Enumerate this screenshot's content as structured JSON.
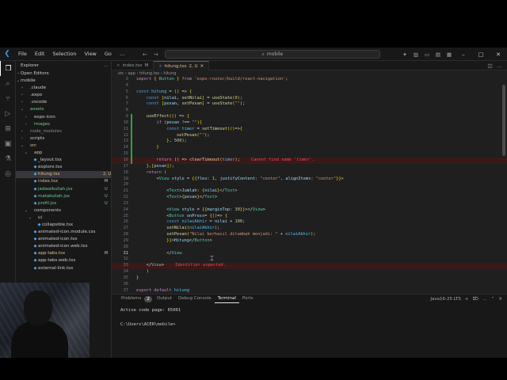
{
  "titlebar": {
    "menu": [
      "File",
      "Edit",
      "Selection",
      "View",
      "Go"
    ],
    "more": "…",
    "search": "mobile"
  },
  "sidebar": {
    "title": "Explorer",
    "section": "Open Editors",
    "root": "mobile",
    "items": [
      {
        "label": ".claude",
        "indent": 1,
        "chev": "›",
        "color": "#cccccc",
        "badge": ""
      },
      {
        "label": ".expo",
        "indent": 1,
        "chev": "›",
        "color": "#cccccc",
        "badge": ""
      },
      {
        "label": ".vscode",
        "indent": 1,
        "chev": "›",
        "color": "#cccccc",
        "badge": ""
      },
      {
        "label": "assets",
        "indent": 1,
        "chev": "⌄",
        "color": "#73c991",
        "badge": ""
      },
      {
        "label": "expo-icon",
        "indent": 2,
        "chev": "›",
        "color": "#cccccc",
        "badge": ""
      },
      {
        "label": "images",
        "indent": 2,
        "chev": "›",
        "color": "#73c991",
        "badge": ""
      },
      {
        "label": "node_modules",
        "indent": 1,
        "chev": "›",
        "color": "#8c8c8c",
        "badge": ""
      },
      {
        "label": "scripts",
        "indent": 1,
        "chev": "›",
        "color": "#cccccc",
        "badge": ""
      },
      {
        "label": "src",
        "indent": 1,
        "chev": "⌄",
        "color": "#e2c08d",
        "badge": ""
      },
      {
        "label": "app",
        "indent": 2,
        "chev": "⌄",
        "color": "#e2c08d",
        "badge": ""
      },
      {
        "label": "_layout.tsx",
        "indent": 3,
        "chev": "",
        "color": "#cccccc",
        "badge": ""
      },
      {
        "label": "explore.tsx",
        "indent": 3,
        "chev": "",
        "color": "#cccccc",
        "badge": ""
      },
      {
        "label": "hitung.tsx",
        "indent": 3,
        "chev": "",
        "color": "#e2c08d",
        "badge": "2, U",
        "selected": true
      },
      {
        "label": "index.tsx",
        "indent": 3,
        "chev": "",
        "color": "#e2c08d",
        "badge": "M"
      },
      {
        "label": "jadwalkuliah.jsx",
        "indent": 3,
        "chev": "",
        "color": "#73c991",
        "badge": "U"
      },
      {
        "label": "matakuliah.jsx",
        "indent": 3,
        "chev": "",
        "color": "#73c991",
        "badge": "U"
      },
      {
        "label": "profil.jsx",
        "indent": 3,
        "chev": "",
        "color": "#73c991",
        "badge": "U"
      },
      {
        "label": "components",
        "indent": 2,
        "chev": "⌄",
        "color": "#cccccc",
        "badge": ""
      },
      {
        "label": "ui",
        "indent": 3,
        "chev": "⌄",
        "color": "#cccccc",
        "badge": ""
      },
      {
        "label": "collapsible.tsx",
        "indent": 4,
        "chev": "",
        "color": "#cccccc",
        "badge": ""
      },
      {
        "label": "animated-icon.module.css",
        "indent": 3,
        "chev": "",
        "color": "#cccccc",
        "badge": ""
      },
      {
        "label": "animated-icon.tsx",
        "indent": 3,
        "chev": "",
        "color": "#cccccc",
        "badge": ""
      },
      {
        "label": "animated-icon.web.tsx",
        "indent": 3,
        "chev": "",
        "color": "#cccccc",
        "badge": ""
      },
      {
        "label": "app-tabs.tsx",
        "indent": 3,
        "chev": "",
        "color": "#e2c08d",
        "badge": "M"
      },
      {
        "label": "app-tabs.web.tsx",
        "indent": 3,
        "chev": "",
        "color": "#cccccc",
        "badge": ""
      },
      {
        "label": "external-link.tsx",
        "indent": 3,
        "chev": "",
        "color": "#cccccc",
        "badge": ""
      }
    ]
  },
  "tabs": [
    {
      "label": "index.tsx",
      "badge": "M",
      "active": false
    },
    {
      "label": "hitung.tsx",
      "badge": "2, U",
      "active": true
    }
  ],
  "breadcrumb": "src › app › hitung.tsx › hitung",
  "code": [
    {
      "n": "3",
      "text": "import { Button } from 'expo-router/build/react-navigation';"
    },
    {
      "n": "4",
      "text": ""
    },
    {
      "n": "5",
      "text": "const hitung = () => {"
    },
    {
      "n": "6",
      "text": "    const [nilai, setNilai] = useState(0);"
    },
    {
      "n": "7",
      "text": "    const [pesan, setPesan] = useState(\"\");"
    },
    {
      "n": "8",
      "text": ""
    },
    {
      "n": "9",
      "text": "    useEffect(() => {"
    },
    {
      "n": "10",
      "text": "        if (pesan !== \"\"){"
    },
    {
      "n": "11",
      "text": "            const timer = setTimeout(()=>{"
    },
    {
      "n": "12",
      "text": "                setPesan(\"\");"
    },
    {
      "n": "13",
      "text": "            }, 500);"
    },
    {
      "n": "14",
      "text": "        }"
    },
    {
      "n": "15",
      "text": ""
    },
    {
      "n": "16",
      "text": "        return () => clearTimeout(timer);",
      "error": "Cannot find name 'timer'."
    },
    {
      "n": "17",
      "text": "    },[pesan]);"
    },
    {
      "n": "18",
      "text": "    return ("
    },
    {
      "n": "19",
      "text": "        <View style = {{flex: 1, justifyContent: \"center\", alignItems: \"center\"}}>"
    },
    {
      "n": "20",
      "text": ""
    },
    {
      "n": "21",
      "text": "            <Text>Jumlah: {nilai}</Text>"
    },
    {
      "n": "22",
      "text": "            <Text>{pesan}</Text>"
    },
    {
      "n": "23",
      "text": ""
    },
    {
      "n": "24",
      "text": "            <View style = {{marginTop: 30}}></View>"
    },
    {
      "n": "25",
      "text": "            <Button onPress= {()=> {"
    },
    {
      "n": "26",
      "text": "            const nilaiAkhir = nilai + 100;"
    },
    {
      "n": "27",
      "text": "            setNilai(nilaiAkhir);"
    },
    {
      "n": "28",
      "text": "            setPesan(\"Nilai berhasil ditambah menjadi: \" + nilaiAkhir);"
    },
    {
      "n": "29",
      "text": "            }}>Hitung</Button>"
    },
    {
      "n": "30",
      "text": ""
    },
    {
      "n": "31",
      "text": "            </View"
    },
    {
      "n": "32",
      "text": ""
    },
    {
      "n": "33",
      "text": "    </View>",
      "error": "Identifier expected."
    },
    {
      "n": "34",
      "text": "    )"
    },
    {
      "n": "35",
      "text": "}"
    },
    {
      "n": "36",
      "text": ""
    },
    {
      "n": "37",
      "text": "export default hitung"
    }
  ],
  "panel": {
    "tabs": [
      "Problems",
      "Output",
      "Debug Console",
      "Terminal",
      "Ports"
    ],
    "problems_count": "2",
    "active": "Terminal",
    "shell": "Java16-25 LTS",
    "terminal_lines": [
      "Active code page: 65001",
      "",
      "C:\\Users\\ACER\\mobile>"
    ]
  }
}
